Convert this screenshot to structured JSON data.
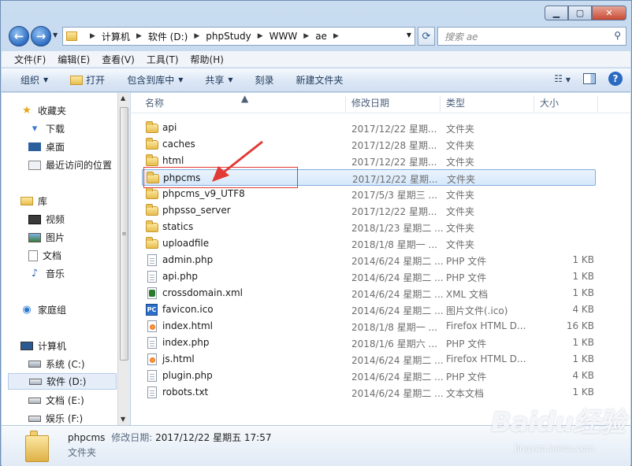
{
  "window": {
    "minimize": "▁",
    "maximize": "▢",
    "close": "✕"
  },
  "address": {
    "crumbs": [
      "计算机",
      "软件 (D:)",
      "phpStudy",
      "WWW",
      "ae"
    ],
    "search_placeholder": "搜索 ae"
  },
  "menu": [
    "文件(F)",
    "编辑(E)",
    "查看(V)",
    "工具(T)",
    "帮助(H)"
  ],
  "toolbar": {
    "organize": "组织",
    "open": "打开",
    "include": "包含到库中",
    "share": "共享",
    "burn": "刻录",
    "new_folder": "新建文件夹"
  },
  "sidebar": {
    "favorites": "收藏夹",
    "downloads": "下载",
    "desktop": "桌面",
    "recent": "最近访问的位置",
    "libraries": "库",
    "videos": "视频",
    "pictures": "图片",
    "documents": "文档",
    "music": "音乐",
    "homegroup": "家庭组",
    "computer": "计算机",
    "drive_c": "系统 (C:)",
    "drive_d": "软件 (D:)",
    "drive_e": "文档 (E:)",
    "drive_f": "娱乐 (F:)"
  },
  "columns": {
    "name": "名称",
    "date": "修改日期",
    "type": "类型",
    "size": "大小"
  },
  "files": [
    {
      "name": "api",
      "date": "2017/12/22 星期...",
      "type": "文件夹",
      "size": "",
      "icon": "folder"
    },
    {
      "name": "caches",
      "date": "2017/12/28 星期...",
      "type": "文件夹",
      "size": "",
      "icon": "folder"
    },
    {
      "name": "html",
      "date": "2017/12/22 星期...",
      "type": "文件夹",
      "size": "",
      "icon": "folder"
    },
    {
      "name": "phpcms",
      "date": "2017/12/22 星期...",
      "type": "文件夹",
      "size": "",
      "icon": "folder",
      "selected": true
    },
    {
      "name": "phpcms_v9_UTF8",
      "date": "2017/5/3 星期三 ...",
      "type": "文件夹",
      "size": "",
      "icon": "folder"
    },
    {
      "name": "phpsso_server",
      "date": "2017/12/22 星期...",
      "type": "文件夹",
      "size": "",
      "icon": "folder"
    },
    {
      "name": "statics",
      "date": "2018/1/23 星期二 ...",
      "type": "文件夹",
      "size": "",
      "icon": "folder"
    },
    {
      "name": "uploadfile",
      "date": "2018/1/8 星期一 ...",
      "type": "文件夹",
      "size": "",
      "icon": "folder"
    },
    {
      "name": "admin.php",
      "date": "2014/6/24 星期二 ...",
      "type": "PHP 文件",
      "size": "1 KB",
      "icon": "doc"
    },
    {
      "name": "api.php",
      "date": "2014/6/24 星期二 ...",
      "type": "PHP 文件",
      "size": "1 KB",
      "icon": "doc"
    },
    {
      "name": "crossdomain.xml",
      "date": "2014/6/24 星期二 ...",
      "type": "XML 文档",
      "size": "1 KB",
      "icon": "xml"
    },
    {
      "name": "favicon.ico",
      "date": "2014/6/24 星期二 ...",
      "type": "图片文件(.ico)",
      "size": "4 KB",
      "icon": "ico"
    },
    {
      "name": "index.html",
      "date": "2018/1/8 星期一 ...",
      "type": "Firefox HTML D...",
      "size": "16 KB",
      "icon": "firefox"
    },
    {
      "name": "index.php",
      "date": "2018/1/6 星期六 ...",
      "type": "PHP 文件",
      "size": "1 KB",
      "icon": "doc"
    },
    {
      "name": "js.html",
      "date": "2014/6/24 星期二 ...",
      "type": "Firefox HTML D...",
      "size": "1 KB",
      "icon": "firefox"
    },
    {
      "name": "plugin.php",
      "date": "2014/6/24 星期二 ...",
      "type": "PHP 文件",
      "size": "4 KB",
      "icon": "doc"
    },
    {
      "name": "robots.txt",
      "date": "2014/6/24 星期二 ...",
      "type": "文本文档",
      "size": "1 KB",
      "icon": "doc"
    }
  ],
  "status": {
    "name": "phpcms",
    "date_label": "修改日期:",
    "date_value": "2017/12/22 星期五 17:57",
    "type": "文件夹"
  },
  "ico_badge": "PC",
  "watermark": {
    "brand": "Baidu经验",
    "url": "jingyan.baidu.com"
  },
  "colors": {
    "annotation": "#e23a35",
    "selection": "#d6e8fb",
    "accent": "#2b6ac2"
  }
}
